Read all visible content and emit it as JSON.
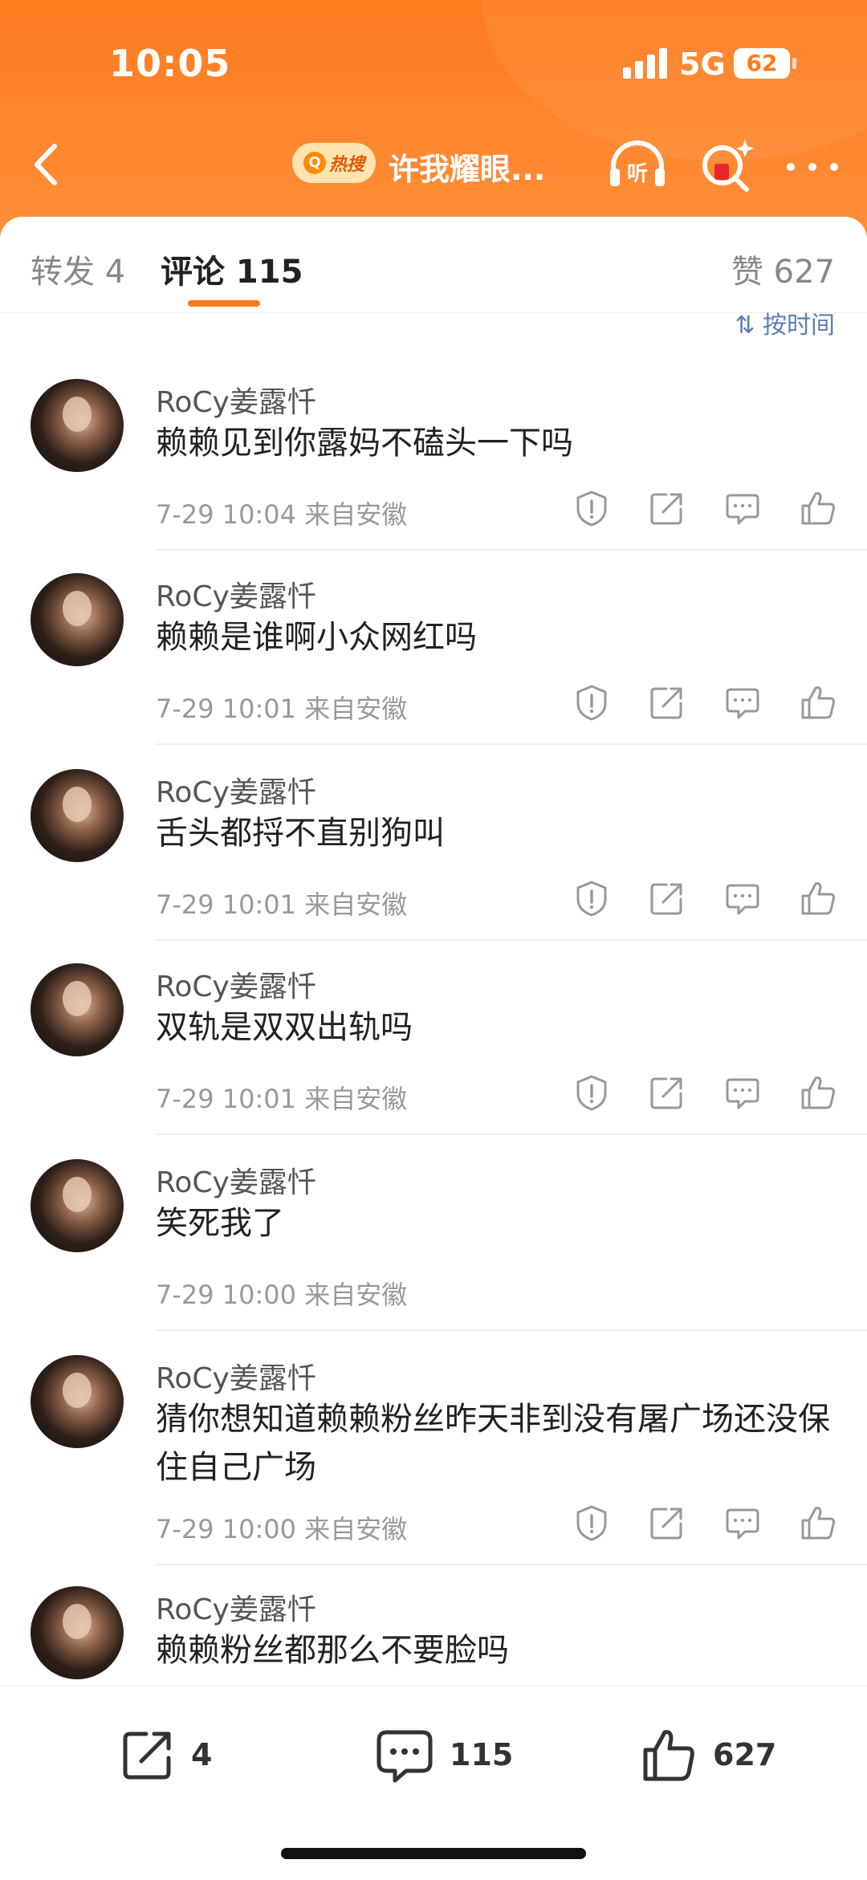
{
  "status_bar": {
    "time": "10:05",
    "network": "5G",
    "battery": "62"
  },
  "header": {
    "hot_label": "热搜",
    "title": "许我耀眼..."
  },
  "tabs": {
    "repost": "转发 4",
    "comment": "评论 115",
    "likes": "赞 627"
  },
  "sort_hint": "按时间",
  "comments": [
    {
      "user": "RoCy姜露忏",
      "text": "赖赖见到你露妈不磕头一下吗",
      "meta": "7-29 10:04 来自安徽"
    },
    {
      "user": "RoCy姜露忏",
      "text": "赖赖是谁啊小众网红吗",
      "meta": "7-29 10:01 来自安徽"
    },
    {
      "user": "RoCy姜露忏",
      "text": "舌头都捋不直别狗叫",
      "meta": "7-29 10:01 来自安徽"
    },
    {
      "user": "RoCy姜露忏",
      "text": "双轨是双双出轨吗",
      "meta": "7-29 10:01 来自安徽"
    },
    {
      "user": "RoCy姜露忏",
      "text": "笑死我了",
      "meta": "7-29 10:00 来自安徽"
    },
    {
      "user": "RoCy姜露忏",
      "text": "猜你想知道赖赖粉丝昨天非到没有屠广场还没保住自己广场",
      "meta": "7-29 10:00 来自安徽"
    },
    {
      "user": "RoCy姜露忏",
      "text": "赖赖粉丝都那么不要脸吗",
      "meta": ""
    }
  ],
  "bottom_bar": {
    "repost_count": "4",
    "comment_count": "115",
    "like_count": "627"
  },
  "colors": {
    "accent": "#ff7a1f",
    "header": "#ff8a33",
    "link": "#5a7fb0"
  }
}
